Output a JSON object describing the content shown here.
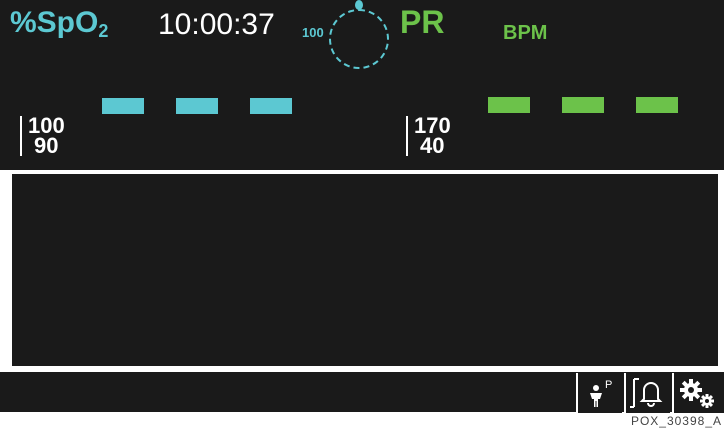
{
  "header": {
    "spo2_label_main": "%SpO",
    "spo2_label_sub": "2",
    "time": "10:00:37",
    "pulse_amplitude_value": "100",
    "pr_label": "PR",
    "pr_unit": "BPM"
  },
  "spo2": {
    "reading_placeholder": "- - -",
    "alarm_limit_high": "100",
    "alarm_limit_low": "90",
    "color": "#5cc8d2"
  },
  "pulse_rate": {
    "reading_placeholder": "- - -",
    "alarm_limit_high": "170",
    "alarm_limit_low": "40",
    "color": "#6cc24a"
  },
  "softkeys": [
    {
      "icon": "patient-mode-icon",
      "badge": "P"
    },
    {
      "icon": "alarm-limits-icon"
    },
    {
      "icon": "settings-gears-icon"
    }
  ],
  "caption": "POX_30398_A",
  "colors": {
    "background": "#1a1a1a",
    "spo2_accent": "#5cc8d2",
    "pr_accent": "#6cc24a",
    "text": "#ffffff"
  }
}
